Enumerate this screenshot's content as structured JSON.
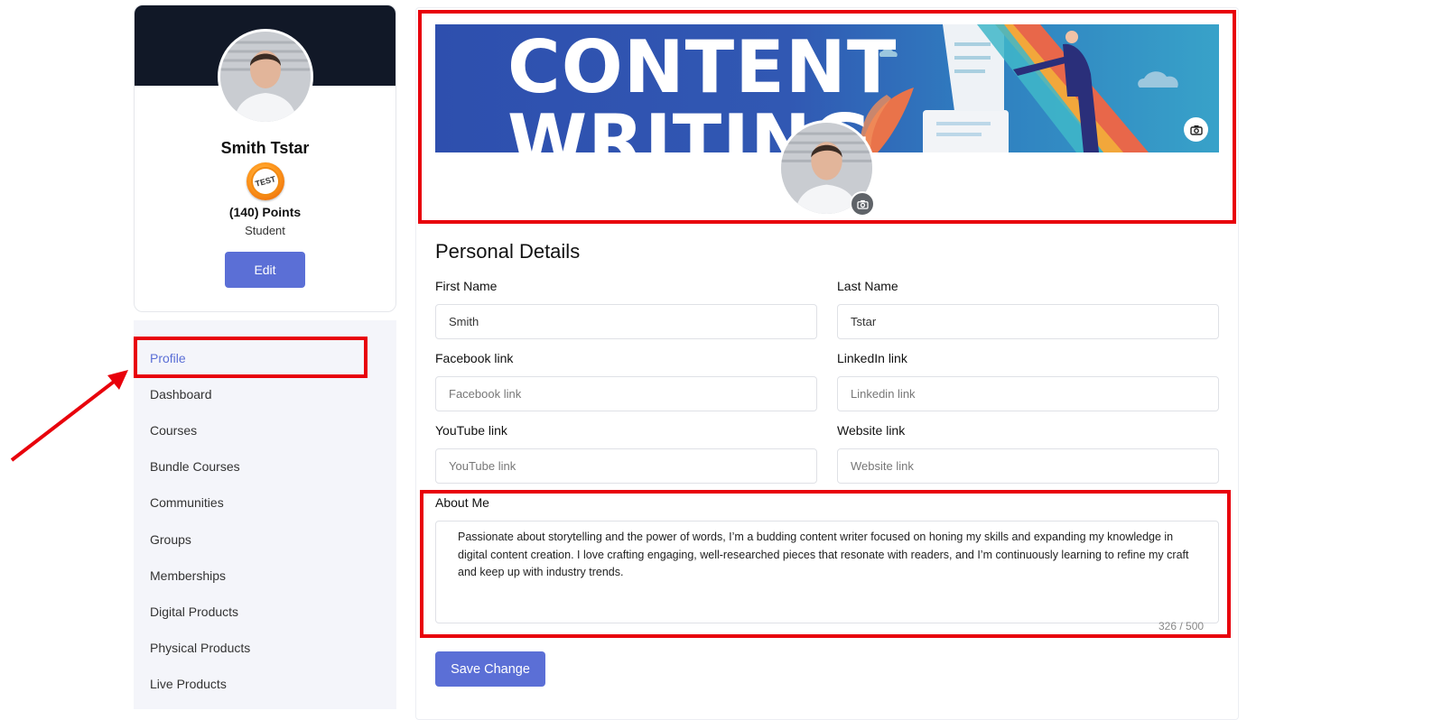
{
  "profile_card": {
    "name": "Smith Tstar",
    "badge_text": "TEST",
    "points": "(140) Points",
    "role": "Student",
    "edit_label": "Edit"
  },
  "sidebar": {
    "items": [
      {
        "label": "Profile",
        "active": true
      },
      {
        "label": "Dashboard"
      },
      {
        "label": "Courses"
      },
      {
        "label": "Bundle Courses"
      },
      {
        "label": "Communities"
      },
      {
        "label": "Groups"
      },
      {
        "label": "Memberships"
      },
      {
        "label": "Digital Products"
      },
      {
        "label": "Physical Products"
      },
      {
        "label": "Live Products"
      }
    ]
  },
  "cover": {
    "line1": "CONTENT",
    "line2": "WRITING"
  },
  "form": {
    "section_title": "Personal Details",
    "first_name": {
      "label": "First Name",
      "value": "Smith",
      "placeholder": ""
    },
    "last_name": {
      "label": "Last Name",
      "value": "Tstar",
      "placeholder": ""
    },
    "facebook": {
      "label": "Facebook link",
      "value": "",
      "placeholder": "Facebook link"
    },
    "linkedin": {
      "label": "LinkedIn link",
      "value": "",
      "placeholder": "Linkedin link"
    },
    "youtube": {
      "label": "YouTube link",
      "value": "",
      "placeholder": "YouTube link"
    },
    "website": {
      "label": "Website link",
      "value": "",
      "placeholder": "Website link"
    },
    "about": {
      "label": "About Me",
      "value": "Passionate about storytelling and the power of words, I’m a budding content writer focused on honing my skills and expanding my knowledge in digital content creation. I love crafting engaging, well-researched pieces that resonate with readers, and I’m continuously learning to refine my craft and keep up with industry trends.",
      "char_count": "326 / 500"
    },
    "save_label": "Save Change"
  },
  "colors": {
    "accent": "#5b6fd6",
    "highlight": "#e8000b",
    "card_banner": "#111827"
  },
  "icons": [
    "camera-icon",
    "arrow-icon",
    "avatar-photo",
    "badge-icon"
  ]
}
